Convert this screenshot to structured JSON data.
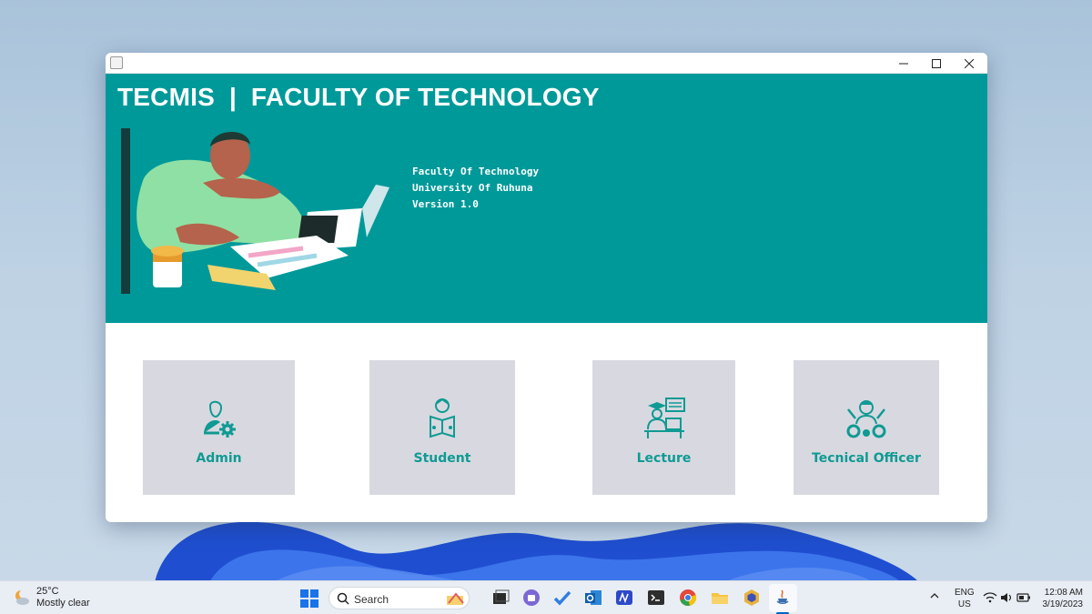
{
  "window": {
    "title": "",
    "banner_title": "TECMIS  |  FACULTY OF TECHNOLOGY",
    "info": {
      "line1": "Faculty Of Technology",
      "line2": "University Of Ruhuna",
      "line3": "Version 1.0"
    },
    "cards": [
      {
        "label": "Admin",
        "icon": "admin-settings-icon"
      },
      {
        "label": "Student",
        "icon": "student-reading-icon"
      },
      {
        "label": "Lecture",
        "icon": "lecturer-board-icon"
      },
      {
        "label": "Tecnical Officer",
        "icon": "technician-gears-icon"
      }
    ],
    "colors": {
      "banner": "#009999",
      "card_bg": "#d8d9e0",
      "card_text": "#0f9a93"
    }
  },
  "taskbar": {
    "weather": {
      "temp": "25°C",
      "condition": "Mostly clear"
    },
    "search_label": "Search",
    "apps": [
      "task-view-icon",
      "teams-icon",
      "todo-icon",
      "outlook-icon",
      "mail-app-icon",
      "terminal-icon",
      "chrome-icon",
      "file-explorer-icon",
      "dev-app-icon",
      "java-app-icon"
    ],
    "lang_line1": "ENG",
    "lang_line2": "US",
    "time": "12:08 AM",
    "date": "3/19/2023"
  }
}
